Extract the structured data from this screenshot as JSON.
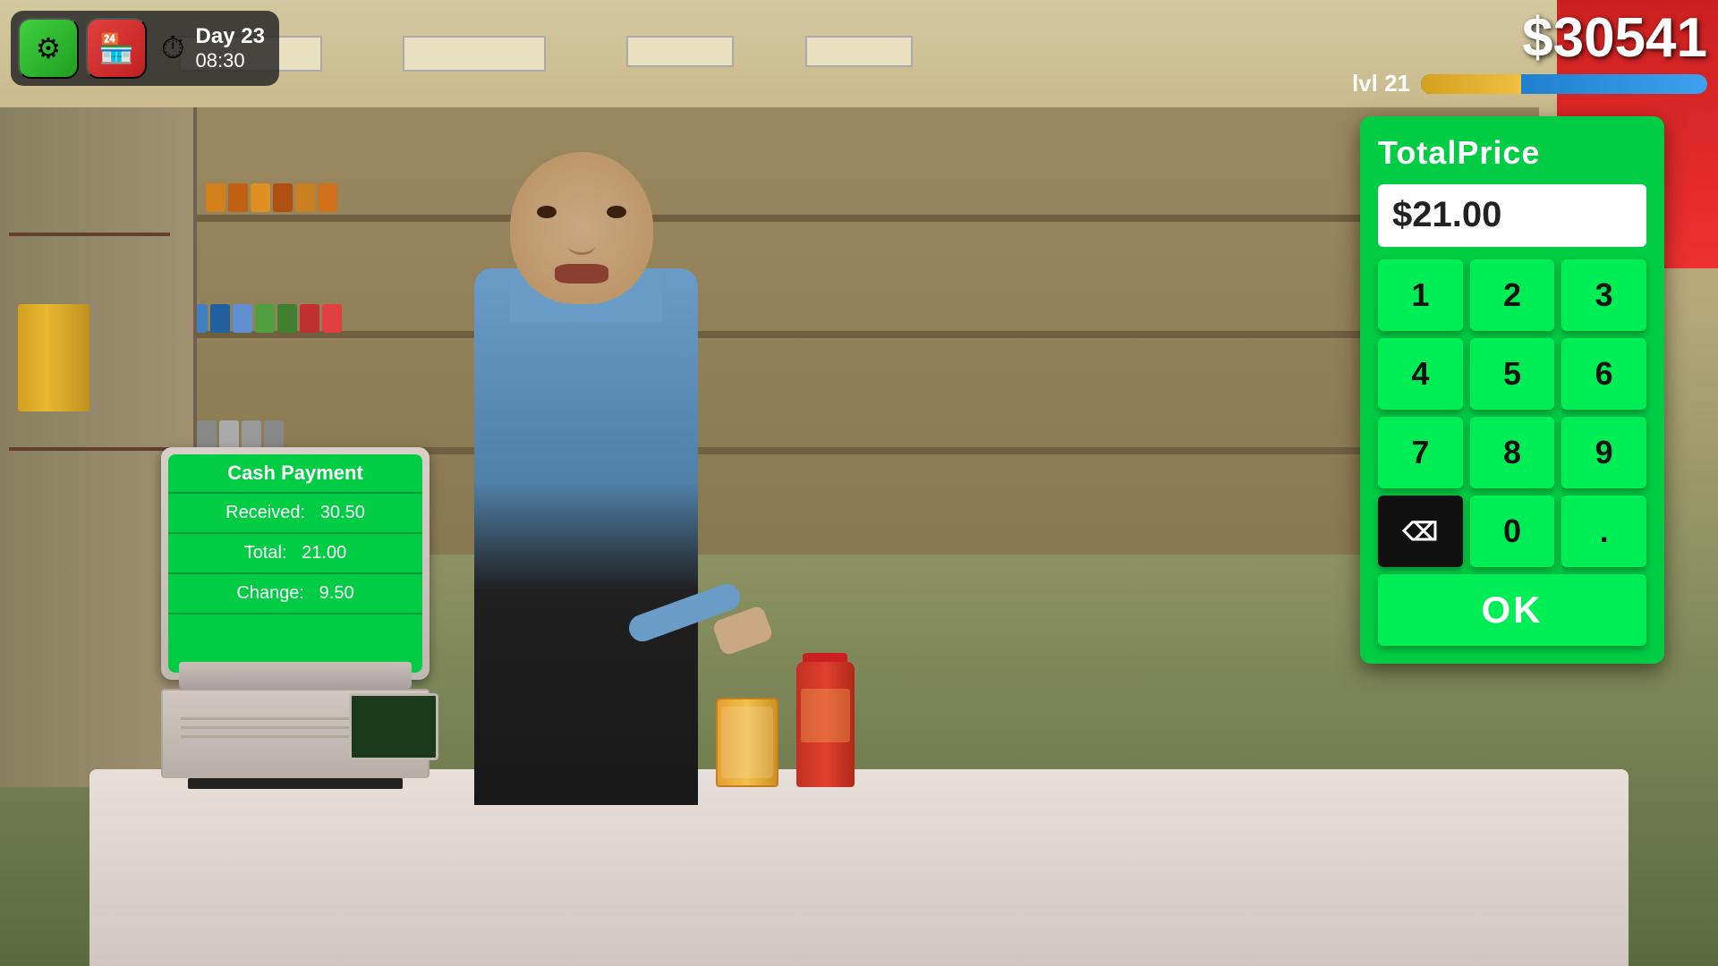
{
  "hud": {
    "money": "$30541",
    "level": "lvl 21",
    "day": "Day 23",
    "time": "08:30",
    "xp_gold_pct": 35,
    "xp_blue_pct": 65
  },
  "buttons": {
    "settings_icon": "⚙",
    "store_icon": "🏪",
    "timer_icon": "⏱"
  },
  "cash_payment": {
    "title": "Cash Payment",
    "received_label": "Received:",
    "received_value": "30.50",
    "total_label": "Total:",
    "total_value": "21.00",
    "change_label": "Change:",
    "change_value": "9.50"
  },
  "numpad": {
    "title": "TotalPrice",
    "display_value": "$21.00",
    "keys": [
      "1",
      "2",
      "3",
      "4",
      "5",
      "6",
      "7",
      "8",
      "9",
      "0",
      "."
    ],
    "ok_label": "OK",
    "backspace_symbol": "⌫"
  },
  "colors": {
    "green_main": "#00cc44",
    "green_btn": "#00ee55",
    "black": "#111111",
    "white": "#ffffff"
  }
}
